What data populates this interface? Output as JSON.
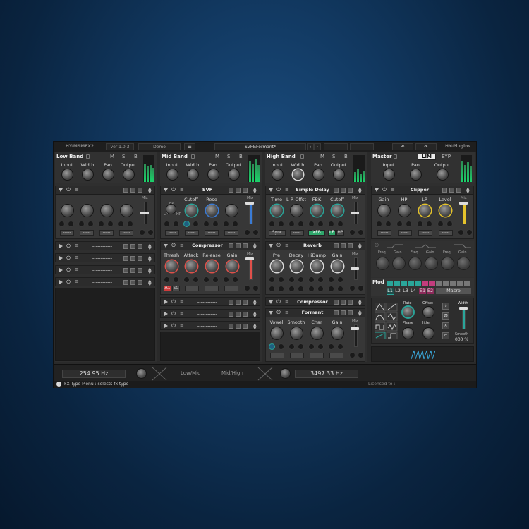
{
  "header": {
    "product": "HY-MSMFX2",
    "version": "ver 1.0.3",
    "mode": "Demo",
    "preset": "SVF&Formant*",
    "slot_a": "-----",
    "slot_b": "-----",
    "brand": "HY-Plugins"
  },
  "bands": [
    {
      "title": "Low Band",
      "knobs": [
        "Input",
        "Width",
        "Pan",
        "Output"
      ],
      "slots_collapsed": [
        "------------",
        "------------",
        "------------",
        "------------"
      ]
    },
    {
      "title": "Mid Band",
      "knobs": [
        "Input",
        "Width",
        "Pan",
        "Output"
      ]
    },
    {
      "title": "High Band",
      "knobs": [
        "Input",
        "Width",
        "Pan",
        "Output"
      ]
    }
  ],
  "msb": {
    "m": "M",
    "s": "S",
    "b": "B"
  },
  "low_slot": {
    "name": "------------",
    "mix": "Mix",
    "buttons": [
      "-----",
      "-----",
      "-----",
      "-----"
    ]
  },
  "svf": {
    "name": "SVF",
    "knobs": [
      "Cutoff",
      "Reso"
    ],
    "mix": "Mix",
    "bp": "BP",
    "lp": "LP",
    "hp": "HP"
  },
  "compressor": {
    "name": "Compressor",
    "knobs": [
      "Thresh",
      "Attack",
      "Release",
      "Gain"
    ],
    "mix": "Mix",
    "btn1": "A1",
    "btn2": "SC"
  },
  "mid_collapsed": [
    "------------",
    "------------",
    "------------"
  ],
  "delay": {
    "name": "Simple Delay",
    "knobs": [
      "Time",
      "L-R Offst",
      "FBK",
      "Cutoff"
    ],
    "mix": "Mix",
    "sync": "Sync",
    "xfb": "XFB",
    "lp": "LP",
    "hp": "HP"
  },
  "reverb": {
    "name": "Reverb",
    "knobs": [
      "Pre",
      "Decay",
      "HiDamp",
      "Gain"
    ],
    "mix": "Mix"
  },
  "high_comp": {
    "name": "Compressor"
  },
  "formant": {
    "name": "Formant",
    "knobs": [
      "Vowel",
      "Smooth",
      "Char",
      "Gain"
    ],
    "mix": "Mix"
  },
  "master": {
    "title": "Master",
    "lim": "LIM",
    "byp": "BYP",
    "knobs": [
      "Input",
      "Pan",
      "Output"
    ],
    "clipper": {
      "name": "Clipper",
      "knobs": [
        "Gain",
        "HP",
        "LP",
        "Level"
      ],
      "mix": "Mix"
    },
    "eq_labels": [
      "Freq",
      "Gain",
      "Freq",
      "Gain",
      "Freq",
      "Gain"
    ]
  },
  "mod": {
    "title": "Mod",
    "tabs": [
      "L1",
      "L2",
      "L3",
      "L4",
      "E1",
      "E2"
    ],
    "macro": "Macro",
    "knobs": [
      "Rate",
      "Offset",
      "Phase",
      "Jitter"
    ],
    "width": "Width",
    "smooth": "Smooth",
    "smooth_value": "000 %"
  },
  "crossover": {
    "low_freq": "254.95 Hz",
    "low_mid": "Low/Mid",
    "mid_high": "Mid/High",
    "high_freq": "3497.33 Hz"
  },
  "status": {
    "info": "FX Type Menu : selects fx type",
    "licensed": "Licensed to :",
    "owner": "--------- ---------"
  },
  "colors": {
    "teal": "#2aa59a",
    "blue": "#3a7bd5",
    "red": "#e0504a",
    "yellow": "#e5c32b",
    "green": "#2fa66b"
  }
}
